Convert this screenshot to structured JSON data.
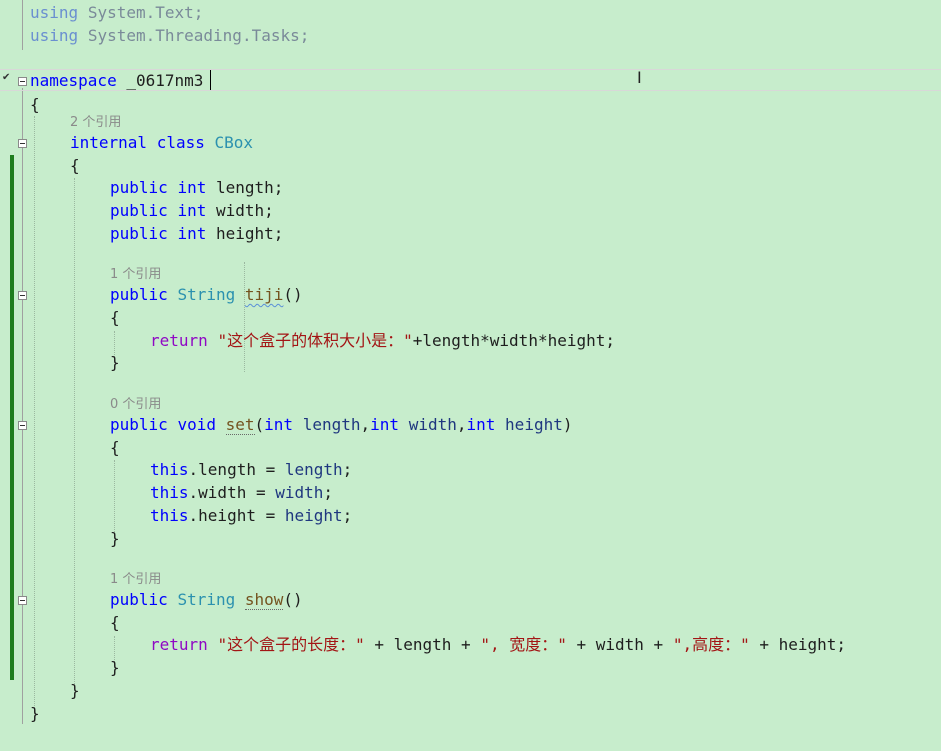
{
  "editor": {
    "using_1": {
      "kw": "using",
      "rest": "System.Text;"
    },
    "using_2": {
      "kw": "using",
      "rest": "System.Threading.Tasks;"
    },
    "ns_kw": "namespace",
    "ns_name": "_0617nm3",
    "brace_open": "{",
    "brace_close": "}",
    "class_refs": "2 个引用",
    "class_mod": "internal",
    "class_kw": "class",
    "class_name": "CBox",
    "field_public": "public",
    "field_type": "int",
    "field_length": "length;",
    "field_width": "width;",
    "field_height": "height;",
    "tiji_refs": "1 个引用",
    "type_string": "String",
    "tiji_name": "tiji",
    "parens": "()",
    "return_kw": "return",
    "tiji_str": "\"这个盒子的体积大小是：\"",
    "tiji_expr": "+length*width*height;",
    "set_refs": "0 个引用",
    "void_kw": "void",
    "set_name": "set",
    "set_open": "(",
    "p_int": "int",
    "p_length": "length",
    "p_width": "width",
    "p_height": "height",
    "comma": ",",
    "set_close": ")",
    "this_kw": "this",
    "assign_length": ".length = ",
    "assign_width": ".width = ",
    "assign_height": ".height = ",
    "semicolon": ";",
    "show_refs": "1 个引用",
    "show_name": "show",
    "show_s1": "\"这个盒子的长度：\"",
    "show_p1": " + length + ",
    "show_s2": "\", 宽度：\"",
    "show_p2": " + width + ",
    "show_s3": "\",高度：\"",
    "show_p3": " + height;"
  },
  "colors": {
    "background": "#c7edcc",
    "keyword": "#0000ff",
    "type": "#2b91af",
    "string": "#a31515",
    "control_keyword": "#8f08c4",
    "change_bar": "#1e7d1e"
  }
}
